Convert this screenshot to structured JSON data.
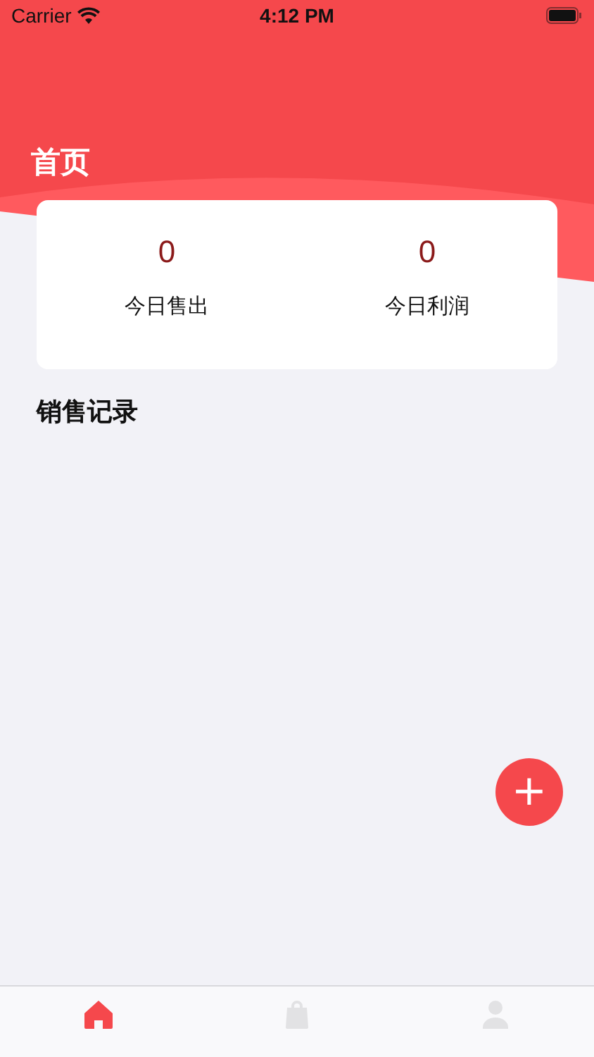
{
  "status_bar": {
    "carrier": "Carrier",
    "time": "4:12 PM"
  },
  "header": {
    "title": "首页"
  },
  "stats": [
    {
      "value": "0",
      "label": "今日售出"
    },
    {
      "value": "0",
      "label": "今日利润"
    }
  ],
  "section": {
    "title": "销售记录"
  },
  "fab": {
    "label": "+"
  },
  "tab_bar": [
    {
      "kind": "home",
      "selected": true
    },
    {
      "kind": "bag",
      "selected": false
    },
    {
      "kind": "person",
      "selected": false
    }
  ]
}
